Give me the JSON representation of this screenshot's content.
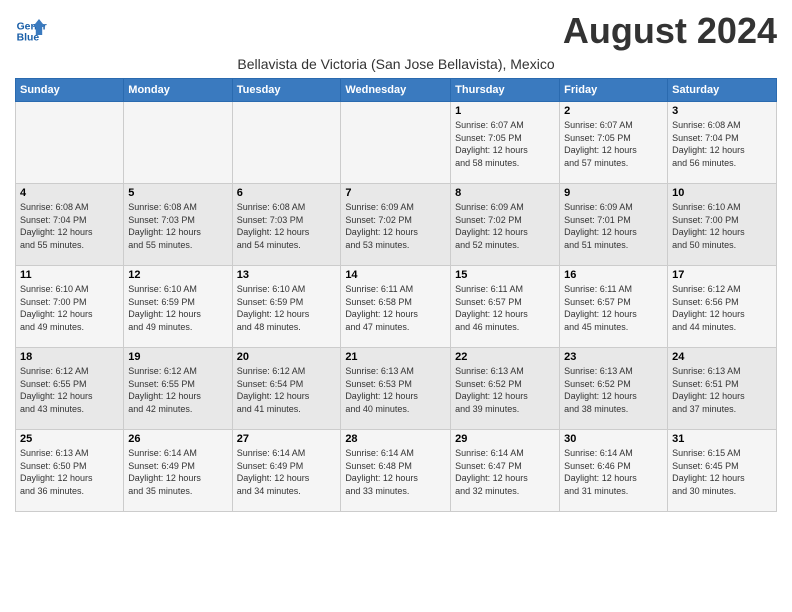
{
  "header": {
    "logo_line1": "General",
    "logo_line2": "Blue",
    "month": "August 2024",
    "location": "Bellavista de Victoria (San Jose Bellavista), Mexico"
  },
  "days_of_week": [
    "Sunday",
    "Monday",
    "Tuesday",
    "Wednesday",
    "Thursday",
    "Friday",
    "Saturday"
  ],
  "weeks": [
    [
      {
        "day": "",
        "info": ""
      },
      {
        "day": "",
        "info": ""
      },
      {
        "day": "",
        "info": ""
      },
      {
        "day": "",
        "info": ""
      },
      {
        "day": "1",
        "info": "Sunrise: 6:07 AM\nSunset: 7:05 PM\nDaylight: 12 hours\nand 58 minutes."
      },
      {
        "day": "2",
        "info": "Sunrise: 6:07 AM\nSunset: 7:05 PM\nDaylight: 12 hours\nand 57 minutes."
      },
      {
        "day": "3",
        "info": "Sunrise: 6:08 AM\nSunset: 7:04 PM\nDaylight: 12 hours\nand 56 minutes."
      }
    ],
    [
      {
        "day": "4",
        "info": "Sunrise: 6:08 AM\nSunset: 7:04 PM\nDaylight: 12 hours\nand 55 minutes."
      },
      {
        "day": "5",
        "info": "Sunrise: 6:08 AM\nSunset: 7:03 PM\nDaylight: 12 hours\nand 55 minutes."
      },
      {
        "day": "6",
        "info": "Sunrise: 6:08 AM\nSunset: 7:03 PM\nDaylight: 12 hours\nand 54 minutes."
      },
      {
        "day": "7",
        "info": "Sunrise: 6:09 AM\nSunset: 7:02 PM\nDaylight: 12 hours\nand 53 minutes."
      },
      {
        "day": "8",
        "info": "Sunrise: 6:09 AM\nSunset: 7:02 PM\nDaylight: 12 hours\nand 52 minutes."
      },
      {
        "day": "9",
        "info": "Sunrise: 6:09 AM\nSunset: 7:01 PM\nDaylight: 12 hours\nand 51 minutes."
      },
      {
        "day": "10",
        "info": "Sunrise: 6:10 AM\nSunset: 7:00 PM\nDaylight: 12 hours\nand 50 minutes."
      }
    ],
    [
      {
        "day": "11",
        "info": "Sunrise: 6:10 AM\nSunset: 7:00 PM\nDaylight: 12 hours\nand 49 minutes."
      },
      {
        "day": "12",
        "info": "Sunrise: 6:10 AM\nSunset: 6:59 PM\nDaylight: 12 hours\nand 49 minutes."
      },
      {
        "day": "13",
        "info": "Sunrise: 6:10 AM\nSunset: 6:59 PM\nDaylight: 12 hours\nand 48 minutes."
      },
      {
        "day": "14",
        "info": "Sunrise: 6:11 AM\nSunset: 6:58 PM\nDaylight: 12 hours\nand 47 minutes."
      },
      {
        "day": "15",
        "info": "Sunrise: 6:11 AM\nSunset: 6:57 PM\nDaylight: 12 hours\nand 46 minutes."
      },
      {
        "day": "16",
        "info": "Sunrise: 6:11 AM\nSunset: 6:57 PM\nDaylight: 12 hours\nand 45 minutes."
      },
      {
        "day": "17",
        "info": "Sunrise: 6:12 AM\nSunset: 6:56 PM\nDaylight: 12 hours\nand 44 minutes."
      }
    ],
    [
      {
        "day": "18",
        "info": "Sunrise: 6:12 AM\nSunset: 6:55 PM\nDaylight: 12 hours\nand 43 minutes."
      },
      {
        "day": "19",
        "info": "Sunrise: 6:12 AM\nSunset: 6:55 PM\nDaylight: 12 hours\nand 42 minutes."
      },
      {
        "day": "20",
        "info": "Sunrise: 6:12 AM\nSunset: 6:54 PM\nDaylight: 12 hours\nand 41 minutes."
      },
      {
        "day": "21",
        "info": "Sunrise: 6:13 AM\nSunset: 6:53 PM\nDaylight: 12 hours\nand 40 minutes."
      },
      {
        "day": "22",
        "info": "Sunrise: 6:13 AM\nSunset: 6:52 PM\nDaylight: 12 hours\nand 39 minutes."
      },
      {
        "day": "23",
        "info": "Sunrise: 6:13 AM\nSunset: 6:52 PM\nDaylight: 12 hours\nand 38 minutes."
      },
      {
        "day": "24",
        "info": "Sunrise: 6:13 AM\nSunset: 6:51 PM\nDaylight: 12 hours\nand 37 minutes."
      }
    ],
    [
      {
        "day": "25",
        "info": "Sunrise: 6:13 AM\nSunset: 6:50 PM\nDaylight: 12 hours\nand 36 minutes."
      },
      {
        "day": "26",
        "info": "Sunrise: 6:14 AM\nSunset: 6:49 PM\nDaylight: 12 hours\nand 35 minutes."
      },
      {
        "day": "27",
        "info": "Sunrise: 6:14 AM\nSunset: 6:49 PM\nDaylight: 12 hours\nand 34 minutes."
      },
      {
        "day": "28",
        "info": "Sunrise: 6:14 AM\nSunset: 6:48 PM\nDaylight: 12 hours\nand 33 minutes."
      },
      {
        "day": "29",
        "info": "Sunrise: 6:14 AM\nSunset: 6:47 PM\nDaylight: 12 hours\nand 32 minutes."
      },
      {
        "day": "30",
        "info": "Sunrise: 6:14 AM\nSunset: 6:46 PM\nDaylight: 12 hours\nand 31 minutes."
      },
      {
        "day": "31",
        "info": "Sunrise: 6:15 AM\nSunset: 6:45 PM\nDaylight: 12 hours\nand 30 minutes."
      }
    ]
  ]
}
